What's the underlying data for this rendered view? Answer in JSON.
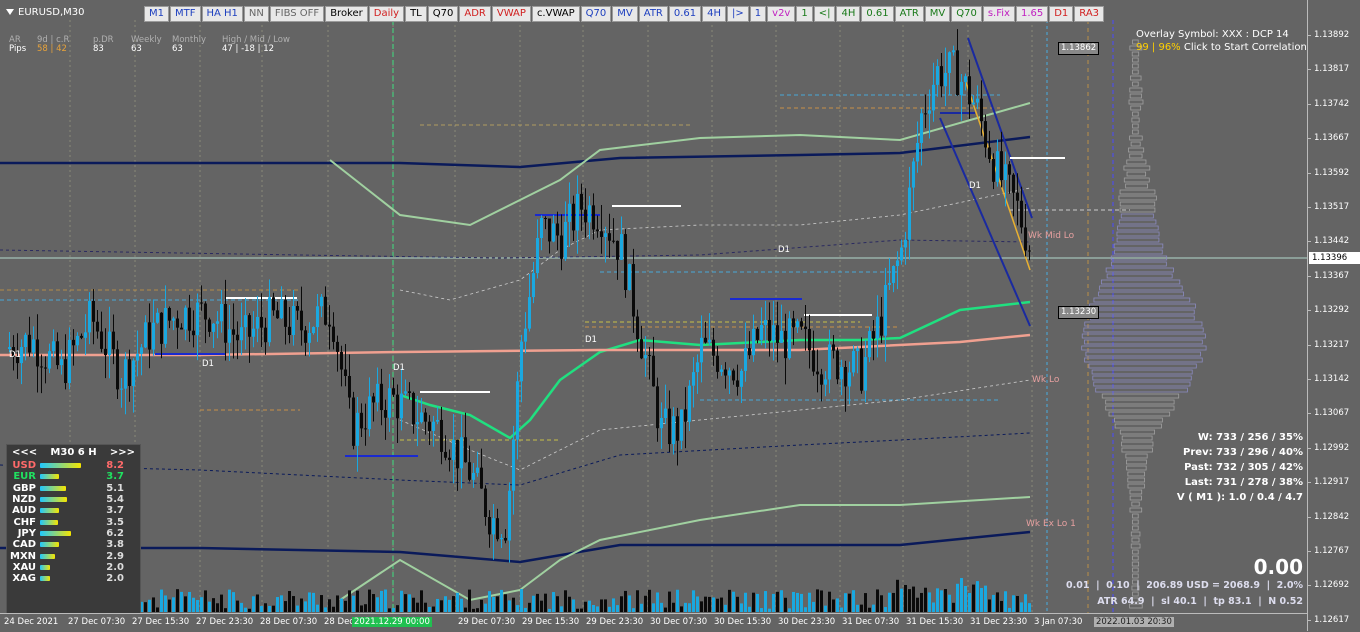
{
  "window": {
    "symbol_title": "EURUSD,M30"
  },
  "toolbar": [
    {
      "label": "M1",
      "color": "#1d3fbf"
    },
    {
      "label": "MTF",
      "color": "#1d3fbf"
    },
    {
      "label": "HA H1",
      "color": "#1d3fbf"
    },
    {
      "label": "NN",
      "color": "#666"
    },
    {
      "label": "FIBS OFF",
      "color": "#666"
    },
    {
      "label": "Broker",
      "color": "#000"
    },
    {
      "label": "Daily",
      "color": "#d12020"
    },
    {
      "label": "TL",
      "color": "#000"
    },
    {
      "label": "Q70",
      "color": "#000"
    },
    {
      "label": "ADR",
      "color": "#d12020"
    },
    {
      "label": "VWAP",
      "color": "#d12020"
    },
    {
      "label": "c.VWAP",
      "color": "#000"
    },
    {
      "label": "Q70",
      "color": "#1d3fbf"
    },
    {
      "label": "MV",
      "color": "#1d3fbf"
    },
    {
      "label": "ATR",
      "color": "#1d3fbf"
    },
    {
      "label": "0.61",
      "color": "#1d3fbf"
    },
    {
      "label": "4H",
      "color": "#1d3fbf"
    },
    {
      "label": "|>",
      "color": "#1d3fbf"
    },
    {
      "label": "1",
      "color": "#1d3fbf"
    },
    {
      "label": "v2v",
      "color": "#c020c0"
    },
    {
      "label": "1",
      "color": "#1a7a1a"
    },
    {
      "label": "<|",
      "color": "#1a7a1a"
    },
    {
      "label": "4H",
      "color": "#1a7a1a"
    },
    {
      "label": "0.61",
      "color": "#1a7a1a"
    },
    {
      "label": "ATR",
      "color": "#1a7a1a"
    },
    {
      "label": "MV",
      "color": "#1a7a1a"
    },
    {
      "label": "Q70",
      "color": "#1a7a1a"
    },
    {
      "label": "s.Fix",
      "color": "#c020c0"
    },
    {
      "label": "1.65",
      "color": "#c020c0"
    },
    {
      "label": "D1",
      "color": "#d12020"
    },
    {
      "label": "RA3",
      "color": "#d12020"
    }
  ],
  "stats_block": {
    "c1": {
      "h": "AR",
      "v": "Pips"
    },
    "c2": {
      "h": "9d | c.R",
      "v": "58 | 42"
    },
    "c3": {
      "h": "p.DR",
      "v": "83"
    },
    "c4": {
      "h": "Weekly",
      "v": "63"
    },
    "c5": {
      "h": "Monthly",
      "v": "63"
    },
    "c6": {
      "h": "High / Mid / Low",
      "v": "47  |  -18  |  12"
    }
  },
  "correlation": {
    "line1": "Overlay Symbol: XXX : DCP 14",
    "line2_a": "99 | 96%",
    "line2_b": " Click to Start Correlation"
  },
  "range_stats": [
    "W: 733 / 256 / 35%",
    "Prev: 733 / 296 / 40%",
    "Past: 732 / 305 / 42%",
    "Last: 731 / 278 / 38%",
    "V ( M1 ): 1.0 / 0.4 / 4.7"
  ],
  "big_value": "0.00",
  "info_line1": "0.01  |  0.10  |  206.89 USD = 2068.9  |  2.0%",
  "info_line2": "ATR 64.9  |  sl 40.1  |  tp 83.1  |  N 0.52",
  "currency_panel": {
    "prev": "<<<",
    "timeframe": "M30  6  H",
    "next": ">>>",
    "rows": [
      {
        "name": "USD",
        "value": "8.2",
        "color": "#ff6a6a",
        "strength": 0.82
      },
      {
        "name": "EUR",
        "value": "3.7",
        "color": "#20e060",
        "strength": 0.37
      },
      {
        "name": "GBP",
        "value": "5.1",
        "color": "#ffffff",
        "strength": 0.51
      },
      {
        "name": "NZD",
        "value": "5.4",
        "color": "#ffffff",
        "strength": 0.54
      },
      {
        "name": "AUD",
        "value": "3.7",
        "color": "#ffffff",
        "strength": 0.37
      },
      {
        "name": "CHF",
        "value": "3.5",
        "color": "#ffffff",
        "strength": 0.35
      },
      {
        "name": "JPY",
        "value": "6.2",
        "color": "#ffffff",
        "strength": 0.62
      },
      {
        "name": "CAD",
        "value": "3.8",
        "color": "#ffffff",
        "strength": 0.38
      },
      {
        "name": "MXN",
        "value": "2.9",
        "color": "#ffffff",
        "strength": 0.29
      },
      {
        "name": "XAU",
        "value": "2.0",
        "color": "#ffffff",
        "strength": 0.2
      },
      {
        "name": "XAG",
        "value": "2.0",
        "color": "#ffffff",
        "strength": 0.2
      }
    ]
  },
  "price_axis": [
    "1.13892",
    "1.13817",
    "1.13742",
    "1.13667",
    "1.13592",
    "1.13517",
    "1.13442",
    "1.13367",
    "1.13292",
    "1.13217",
    "1.13142",
    "1.13067",
    "1.12992",
    "1.12917",
    "1.12842",
    "1.12767",
    "1.12692",
    "1.12617"
  ],
  "current_price": "1.13396",
  "highlight_prices": {
    "top": "1.13862",
    "mid": "1.13230"
  },
  "time_axis": [
    "24 Dec 2021",
    "27 Dec 07:30",
    "27 Dec 15:30",
    "27 Dec 23:30",
    "28 Dec 07:30",
    "28 Dec 15:30",
    "2021.12.29 00:00",
    "29 Dec 07:30",
    "29 Dec 15:30",
    "29 Dec 23:30",
    "30 Dec 07:30",
    "30 Dec 15:30",
    "30 Dec 23:30",
    "31 Dec 07:30",
    "31 Dec 15:30",
    "31 Dec 23:30",
    "3 Jan 07:30",
    "2022.01.03 20:30"
  ],
  "chart_labels": {
    "d1": "D1",
    "wk_mid_lo": "Wk Mid Lo",
    "wk_lo": "Wk Lo",
    "wk_ex_lo": "Wk Ex Lo 1"
  },
  "chart_data": {
    "type": "candlestick",
    "symbol": "EURUSD",
    "timeframe": "M30",
    "ylim": [
      1.1259,
      1.1396
    ],
    "price_path": [
      [
        0,
        1.1318
      ],
      [
        30,
        1.132
      ],
      [
        60,
        1.1313
      ],
      [
        90,
        1.1325
      ],
      [
        120,
        1.1312
      ],
      [
        150,
        1.1322
      ],
      [
        180,
        1.1326
      ],
      [
        210,
        1.1326
      ],
      [
        240,
        1.132
      ],
      [
        270,
        1.1325
      ],
      [
        300,
        1.1323
      ],
      [
        330,
        1.1327
      ],
      [
        350,
        1.13
      ],
      [
        370,
        1.1305
      ],
      [
        390,
        1.1307
      ],
      [
        410,
        1.1304
      ],
      [
        440,
        1.13
      ],
      [
        470,
        1.129
      ],
      [
        490,
        1.128
      ],
      [
        505,
        1.1279
      ],
      [
        520,
        1.132
      ],
      [
        540,
        1.1345
      ],
      [
        560,
        1.1343
      ],
      [
        580,
        1.135
      ],
      [
        600,
        1.1348
      ],
      [
        620,
        1.134
      ],
      [
        640,
        1.132
      ],
      [
        660,
        1.13
      ],
      [
        680,
        1.13
      ],
      [
        700,
        1.1318
      ],
      [
        720,
        1.1316
      ],
      [
        740,
        1.1313
      ],
      [
        760,
        1.1322
      ],
      [
        780,
        1.132
      ],
      [
        800,
        1.132
      ],
      [
        820,
        1.1315
      ],
      [
        840,
        1.1315
      ],
      [
        860,
        1.1313
      ],
      [
        880,
        1.1325
      ],
      [
        900,
        1.134
      ],
      [
        920,
        1.137
      ],
      [
        935,
        1.138
      ],
      [
        955,
        1.138
      ],
      [
        975,
        1.1372
      ],
      [
        995,
        1.1358
      ],
      [
        1015,
        1.135
      ],
      [
        1030,
        1.134
      ]
    ],
    "volume_profile": "price histogram on right side around 1.1320"
  }
}
